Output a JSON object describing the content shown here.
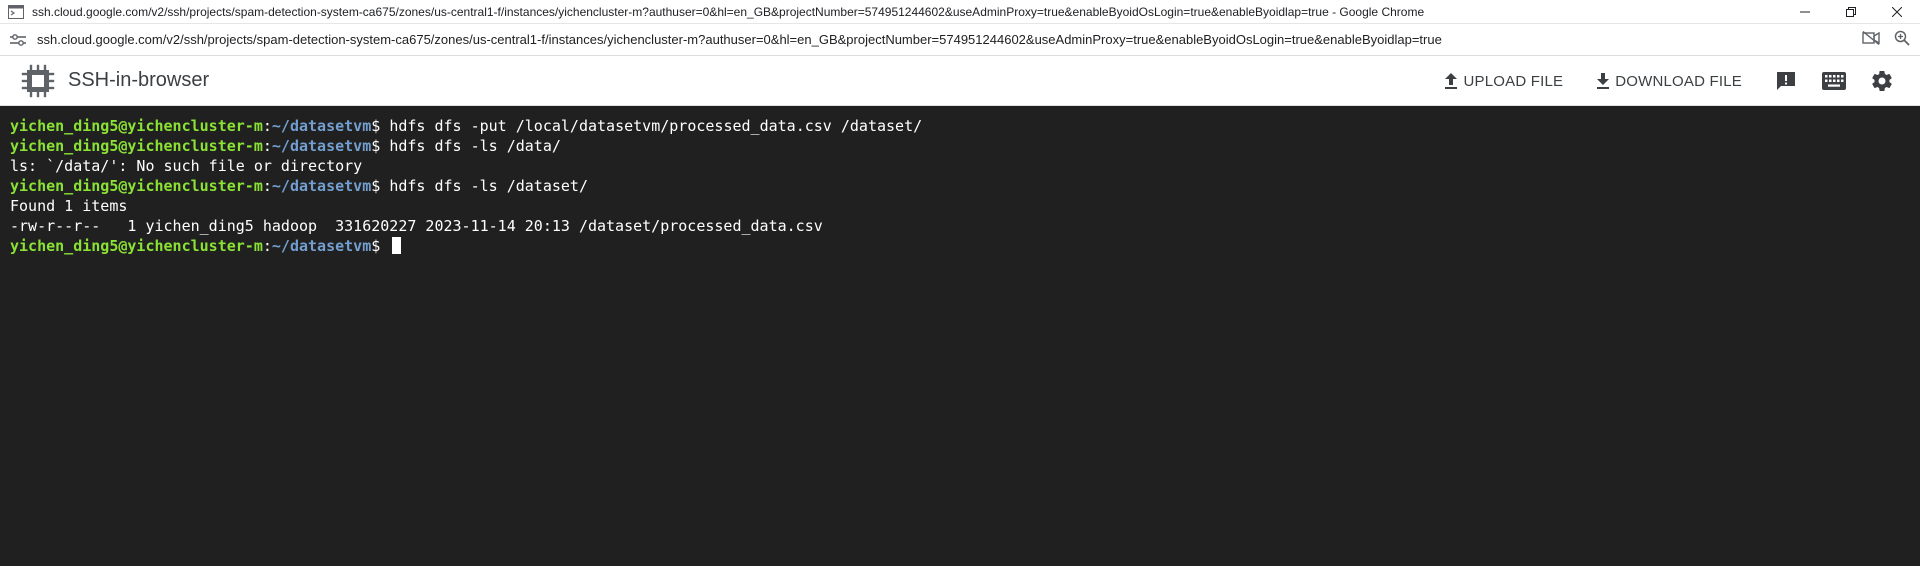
{
  "window": {
    "title": "ssh.cloud.google.com/v2/ssh/projects/spam-detection-system-ca675/zones/us-central1-f/instances/yichencluster-m?authuser=0&hl=en_GB&projectNumber=574951244602&useAdminProxy=true&enableByoidOsLogin=true&enableByoidlap=true - Google Chrome"
  },
  "urlbar": {
    "url": "ssh.cloud.google.com/v2/ssh/projects/spam-detection-system-ca675/zones/us-central1-f/instances/yichencluster-m?authuser=0&hl=en_GB&projectNumber=574951244602&useAdminProxy=true&enableByoidOsLogin=true&enableByoidlap=true"
  },
  "header": {
    "app_title": "SSH-in-browser",
    "upload_label": "UPLOAD FILE",
    "download_label": "DOWNLOAD FILE"
  },
  "terminal": {
    "prompt": {
      "user_host": "yichen_ding5@yichencluster-m",
      "colon": ":",
      "path": "~/datasetvm",
      "dollar": "$ "
    },
    "lines": [
      {
        "type": "cmd",
        "text": "hdfs dfs -put /local/datasetvm/processed_data.csv /dataset/"
      },
      {
        "type": "cmd",
        "text": "hdfs dfs -ls /data/"
      },
      {
        "type": "out",
        "text": "ls: `/data/': No such file or directory"
      },
      {
        "type": "cmd",
        "text": "hdfs dfs -ls /dataset/"
      },
      {
        "type": "out",
        "text": "Found 1 items"
      },
      {
        "type": "out",
        "text": "-rw-r--r--   1 yichen_ding5 hadoop  331620227 2023-11-14 20:13 /dataset/processed_data.csv"
      },
      {
        "type": "cmd",
        "text": ""
      }
    ]
  }
}
